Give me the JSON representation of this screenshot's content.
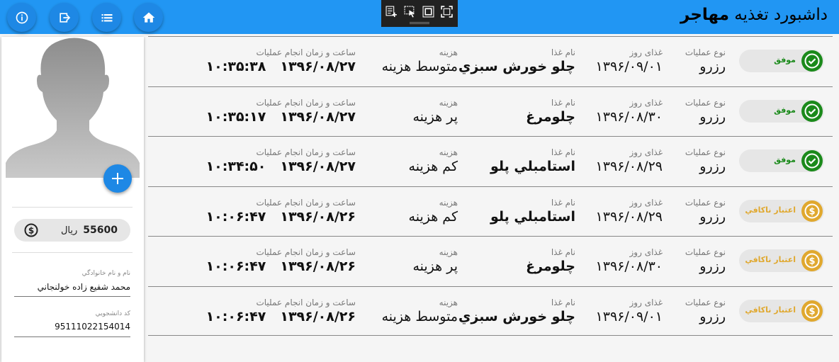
{
  "header": {
    "title_prefix": "داشبورد تغذیه",
    "title_bold": "مهاجر",
    "background": "#2196f3"
  },
  "toolbar_icons": [
    "info-icon",
    "exit-icon",
    "list-icon",
    "home-icon"
  ],
  "profile": {
    "balance_amount": "55600",
    "balance_unit": "ريال",
    "name_label": "نام و نام خانوادگي",
    "name_value": "محمد شفيع زاده خولنجاني",
    "id_label": "كد دانشجويي",
    "id_value": "95111022154014"
  },
  "labels": {
    "op_type": "نوع عمليات",
    "day_food": "غذای روز",
    "food_name": "نام غذا",
    "cost": "هزينه",
    "datetime": "ساعت و زمان انجام عمليات"
  },
  "colors": {
    "success": "#1b8a1b",
    "warning": "#e0a82e"
  },
  "rows": [
    {
      "status": "موفق",
      "kind": "success",
      "op": "رزرو",
      "day": "۱۳۹۶/۰۹/۰۱",
      "food": "چلو خورش سبزي",
      "cost": "متوسط هزينه",
      "date": "۱۳۹۶/۰۸/۲۷",
      "time": "۱۰:۳۵:۳۸"
    },
    {
      "status": "موفق",
      "kind": "success",
      "op": "رزرو",
      "day": "۱۳۹۶/۰۸/۳۰",
      "food": "چلومرغ",
      "cost": "پر هزينه",
      "date": "۱۳۹۶/۰۸/۲۷",
      "time": "۱۰:۳۵:۱۷"
    },
    {
      "status": "موفق",
      "kind": "success",
      "op": "رزرو",
      "day": "۱۳۹۶/۰۸/۲۹",
      "food": "استامبلي پلو",
      "cost": "كم هزينه",
      "date": "۱۳۹۶/۰۸/۲۷",
      "time": "۱۰:۳۴:۵۰"
    },
    {
      "status": "اعتبار ناكافي",
      "kind": "warning",
      "op": "رزرو",
      "day": "۱۳۹۶/۰۸/۲۹",
      "food": "استامبلي پلو",
      "cost": "كم هزينه",
      "date": "۱۳۹۶/۰۸/۲۶",
      "time": "۱۰:۰۶:۴۷"
    },
    {
      "status": "اعتبار ناكافي",
      "kind": "warning",
      "op": "رزرو",
      "day": "۱۳۹۶/۰۸/۳۰",
      "food": "چلومرغ",
      "cost": "پر هزينه",
      "date": "۱۳۹۶/۰۸/۲۶",
      "time": "۱۰:۰۶:۴۷"
    },
    {
      "status": "اعتبار ناكافي",
      "kind": "warning",
      "op": "رزرو",
      "day": "۱۳۹۶/۰۹/۰۱",
      "food": "چلو خورش سبزي",
      "cost": "متوسط هزينه",
      "date": "۱۳۹۶/۰۸/۲۶",
      "time": "۱۰:۰۶:۴۷"
    }
  ]
}
